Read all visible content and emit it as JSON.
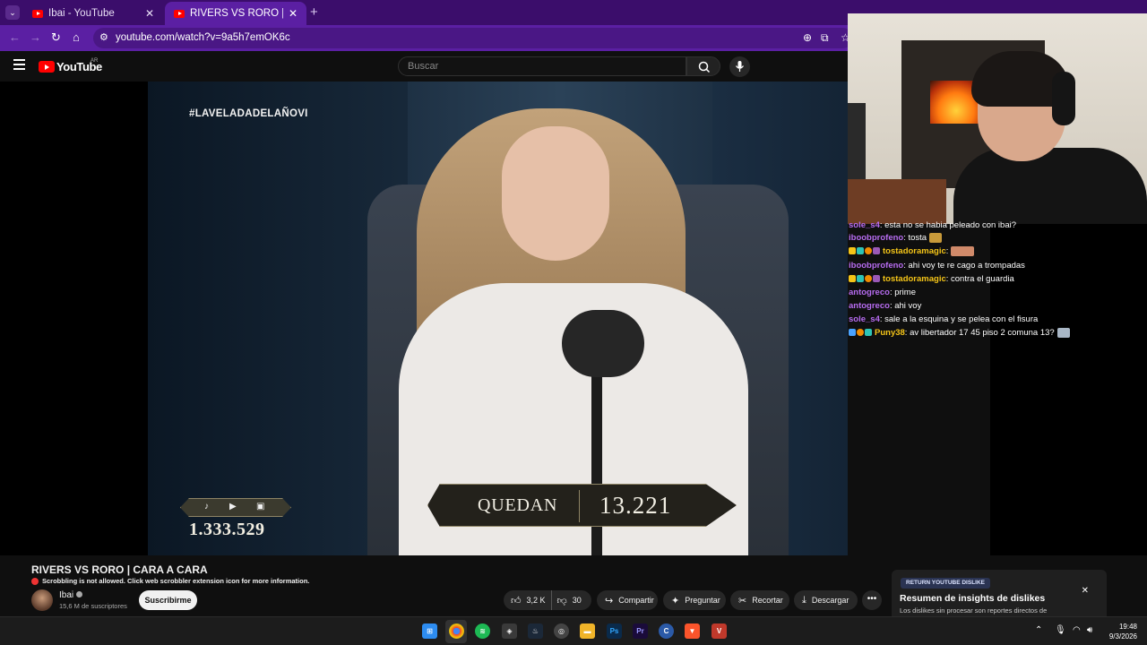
{
  "browser": {
    "tabs": [
      {
        "title": "Ibai - YouTube",
        "active": false
      },
      {
        "title": "RIVERS VS RORO | CARA A CAR",
        "active": true
      }
    ],
    "address": "youtube.com/watch?v=9a5h7emOK6c"
  },
  "youtube": {
    "logo_text": "YouTube",
    "country": "AR",
    "search_placeholder": "Buscar"
  },
  "video_overlay": {
    "hashtag": "#LAVELADADELAÑOVI",
    "viewer_count": "1.333.529",
    "countdown_label": "QUEDAN",
    "countdown_value": "13.221"
  },
  "chat": [
    {
      "badges": [],
      "name": "sole_s4",
      "name_color": "#b76cf0",
      "text": ": esta no se habia peleado con ibai?",
      "emote": false
    },
    {
      "badges": [],
      "name": "iboobprofeno",
      "name_color": "#b76cf0",
      "text": ": tosta",
      "emote": true
    },
    {
      "badges": [
        "#f5c518",
        "#2ec4b6",
        "#f08c00",
        "#9b59b6"
      ],
      "name": "tostadoramagic",
      "name_color": "#f5c518",
      "text": ":",
      "emote": true
    },
    {
      "badges": [],
      "name": "iboobprofeno",
      "name_color": "#b76cf0",
      "text": ": ahi voy te re cago a trompadas",
      "emote": false
    },
    {
      "badges": [
        "#f5c518",
        "#2ec4b6",
        "#f08c00",
        "#9b59b6"
      ],
      "name": "tostadoramagic",
      "name_color": "#f5c518",
      "text": ": contra el guardia",
      "emote": false
    },
    {
      "badges": [],
      "name": "antogreco",
      "name_color": "#b76cf0",
      "text": ": prime",
      "emote": false
    },
    {
      "badges": [],
      "name": "antogreco",
      "name_color": "#b76cf0",
      "text": ": ahi voy",
      "emote": false
    },
    {
      "badges": [],
      "name": "sole_s4",
      "name_color": "#b76cf0",
      "text": ": sale a la esquina y se pelea con el fisura",
      "emote": false
    },
    {
      "badges": [
        "#4aa3ff",
        "#f08c00",
        "#2ec4b6"
      ],
      "name": "Puny38",
      "name_color": "#f5c518",
      "text": ": av libertador 17 45 piso 2 comuna 13?",
      "emote": true
    }
  ],
  "video_info": {
    "title": "RIVERS VS RORO | CARA A CARA",
    "scrobble_notice": "Scrobbling is not allowed. Click web scrobbler extension icon for more information.",
    "channel_name": "Ibai",
    "subscribers": "15,6 M de suscriptores",
    "subscribe_label": "Suscribirme",
    "likes": "3,2 K",
    "dislikes": "30",
    "share_label": "Compartir",
    "ask_label": "Preguntar",
    "clip_label": "Recortar",
    "download_label": "Descargar"
  },
  "ryd_popup": {
    "tag": "RETURN YOUTUBE DISLIKE",
    "title": "Resumen de insights de dislikes",
    "text": "Los dislikes sin procesar son reportes directos de"
  },
  "taskbar": {
    "time": "19:48",
    "date": "9/3/2026"
  },
  "colors": {
    "tab_bar": "#3b0d6b",
    "address_bar": "#5b1fa3",
    "youtube_red": "#ff0000",
    "background": "#0f0f0f"
  }
}
